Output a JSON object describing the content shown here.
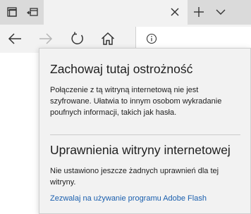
{
  "flyout": {
    "title": "Zachowaj tutaj ostrożność",
    "body": "Połączenie z tą witryną internetową nie jest szyfrowane. Ułatwia to innym osobom wykradanie poufnych informacji, takich jak hasła.",
    "permissions_title": "Uprawnienia witryny internetowej",
    "permissions_body": "Nie ustawiono jeszcze żadnych uprawnień dla tej witryny.",
    "flash_link": "Zezwalaj na używanie programu Adobe Flash"
  },
  "icons": {
    "tab_preview": "tab-preview-icon",
    "set_aside": "set-aside-tabs-icon",
    "close_tab": "close-icon",
    "new_tab": "plus-icon",
    "tab_list": "chevron-down-icon",
    "back": "back-arrow-icon",
    "forward": "forward-arrow-icon",
    "refresh": "refresh-icon",
    "home": "home-icon",
    "site_info": "info-icon"
  },
  "colors": {
    "link": "#1a5fae",
    "flyout_bg": "#f2f2f2",
    "tabstrip_bg": "#dadada"
  }
}
